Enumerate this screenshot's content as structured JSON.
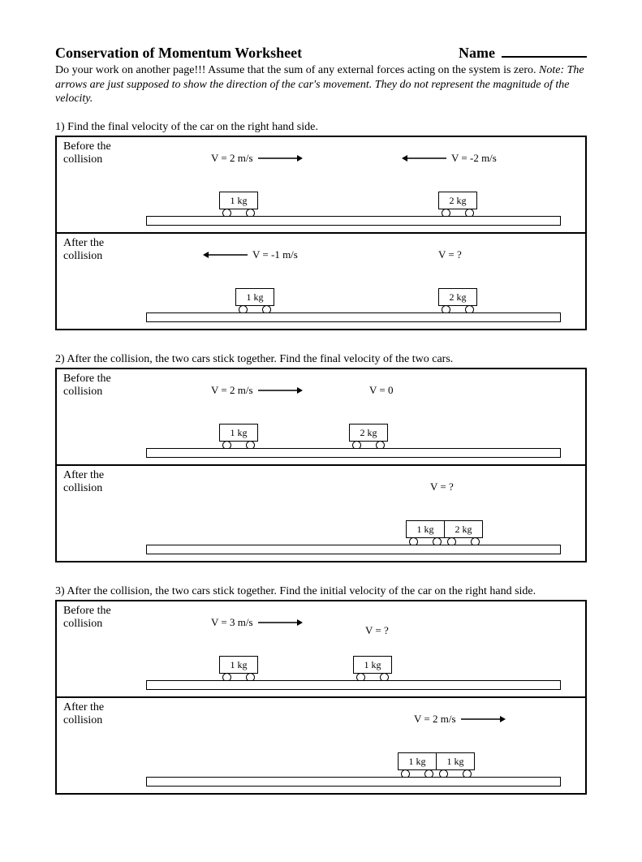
{
  "header": {
    "title": "Conservation of Momentum Worksheet",
    "name_label": "Name"
  },
  "instructions": {
    "line1": "Do your work on another page!!!  Assume that the sum of any external forces acting on the system is zero.  ",
    "note": "Note:  The arrows are just supposed to show the direction of the car's movement.  They do not represent the magnitude of the velocity."
  },
  "labels": {
    "before": "Before the collision",
    "after": "After the collision"
  },
  "p1": {
    "prompt": "1)  Find the final velocity of the car on the right hand side.",
    "b_v1": "V = 2 m/s",
    "b_v2": "V = -2 m/s",
    "b_m1": "1 kg",
    "b_m2": "2 kg",
    "a_v1": "V = -1 m/s",
    "a_v2": "V = ?",
    "a_m1": "1 kg",
    "a_m2": "2 kg"
  },
  "p2": {
    "prompt": "2)  After the collision, the two cars stick together.  Find the final velocity of the two cars.",
    "b_v1": "V = 2 m/s",
    "b_v2": "V = 0",
    "b_m1": "1 kg",
    "b_m2": "2 kg",
    "a_v": "V = ?",
    "a_m1": "1 kg",
    "a_m2": "2 kg"
  },
  "p3": {
    "prompt": "3)  After the collision, the two cars stick together.  Find the initial velocity of the car on the right hand side.",
    "b_v1": "V = 3 m/s",
    "b_v2": "V = ?",
    "b_m1": "1 kg",
    "b_m2": "1 kg",
    "a_v": "V = 2 m/s",
    "a_m1": "1 kg",
    "a_m2": "1 kg"
  }
}
